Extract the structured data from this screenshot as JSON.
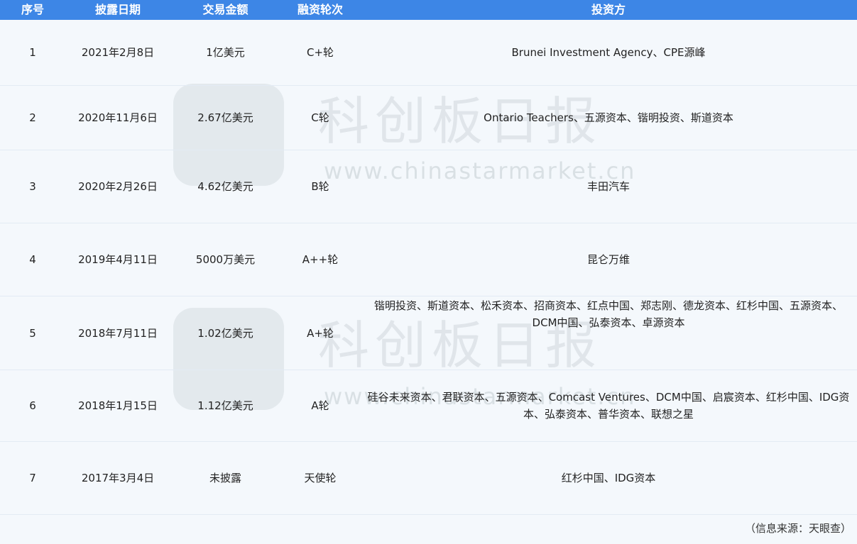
{
  "table": {
    "headers": [
      "序号",
      "披露日期",
      "交易金额",
      "融资轮次",
      "投资方"
    ],
    "rows": [
      {
        "no": "1",
        "date": "2021年2月8日",
        "amount": "1亿美元",
        "round": "C+轮",
        "investors": "Brunei Investment Agency、CPE源峰"
      },
      {
        "no": "2",
        "date": "2020年11月6日",
        "amount": "2.67亿美元",
        "round": "C轮",
        "investors": "Ontario Teachers、五源资本、锴明投资、斯道资本"
      },
      {
        "no": "3",
        "date": "2020年2月26日",
        "amount": "4.62亿美元",
        "round": "B轮",
        "investors": "丰田汽车"
      },
      {
        "no": "4",
        "date": "2019年4月11日",
        "amount": "5000万美元",
        "round": "A++轮",
        "investors": "昆仑万维"
      },
      {
        "no": "5",
        "date": "2018年7月11日",
        "amount": "1.02亿美元",
        "round": "A+轮",
        "investors": "锴明投资、斯道资本、松禾资本、招商资本、红点中国、郑志刚、德龙资本、红杉中国、五源资本、DCM中国、弘泰资本、卓源资本"
      },
      {
        "no": "6",
        "date": "2018年1月15日",
        "amount": "1.12亿美元",
        "round": "A轮",
        "investors": "硅谷未来资本、君联资本、五源资本、Comcast Ventures、DCM中国、启宸资本、红杉中国、IDG资本、弘泰资本、普华资本、联想之星"
      },
      {
        "no": "7",
        "date": "2017年3月4日",
        "amount": "未披露",
        "round": "天使轮",
        "investors": "红杉中国、IDG资本"
      }
    ]
  },
  "source_note": "（信息来源：天眼查）",
  "watermark": {
    "text": "科创板日报",
    "url": "www.chinastarmarket.cn"
  },
  "colors": {
    "header_bg": "#3d86e6",
    "header_text": "#ffffff",
    "page_bg": "#f4f8fc"
  }
}
